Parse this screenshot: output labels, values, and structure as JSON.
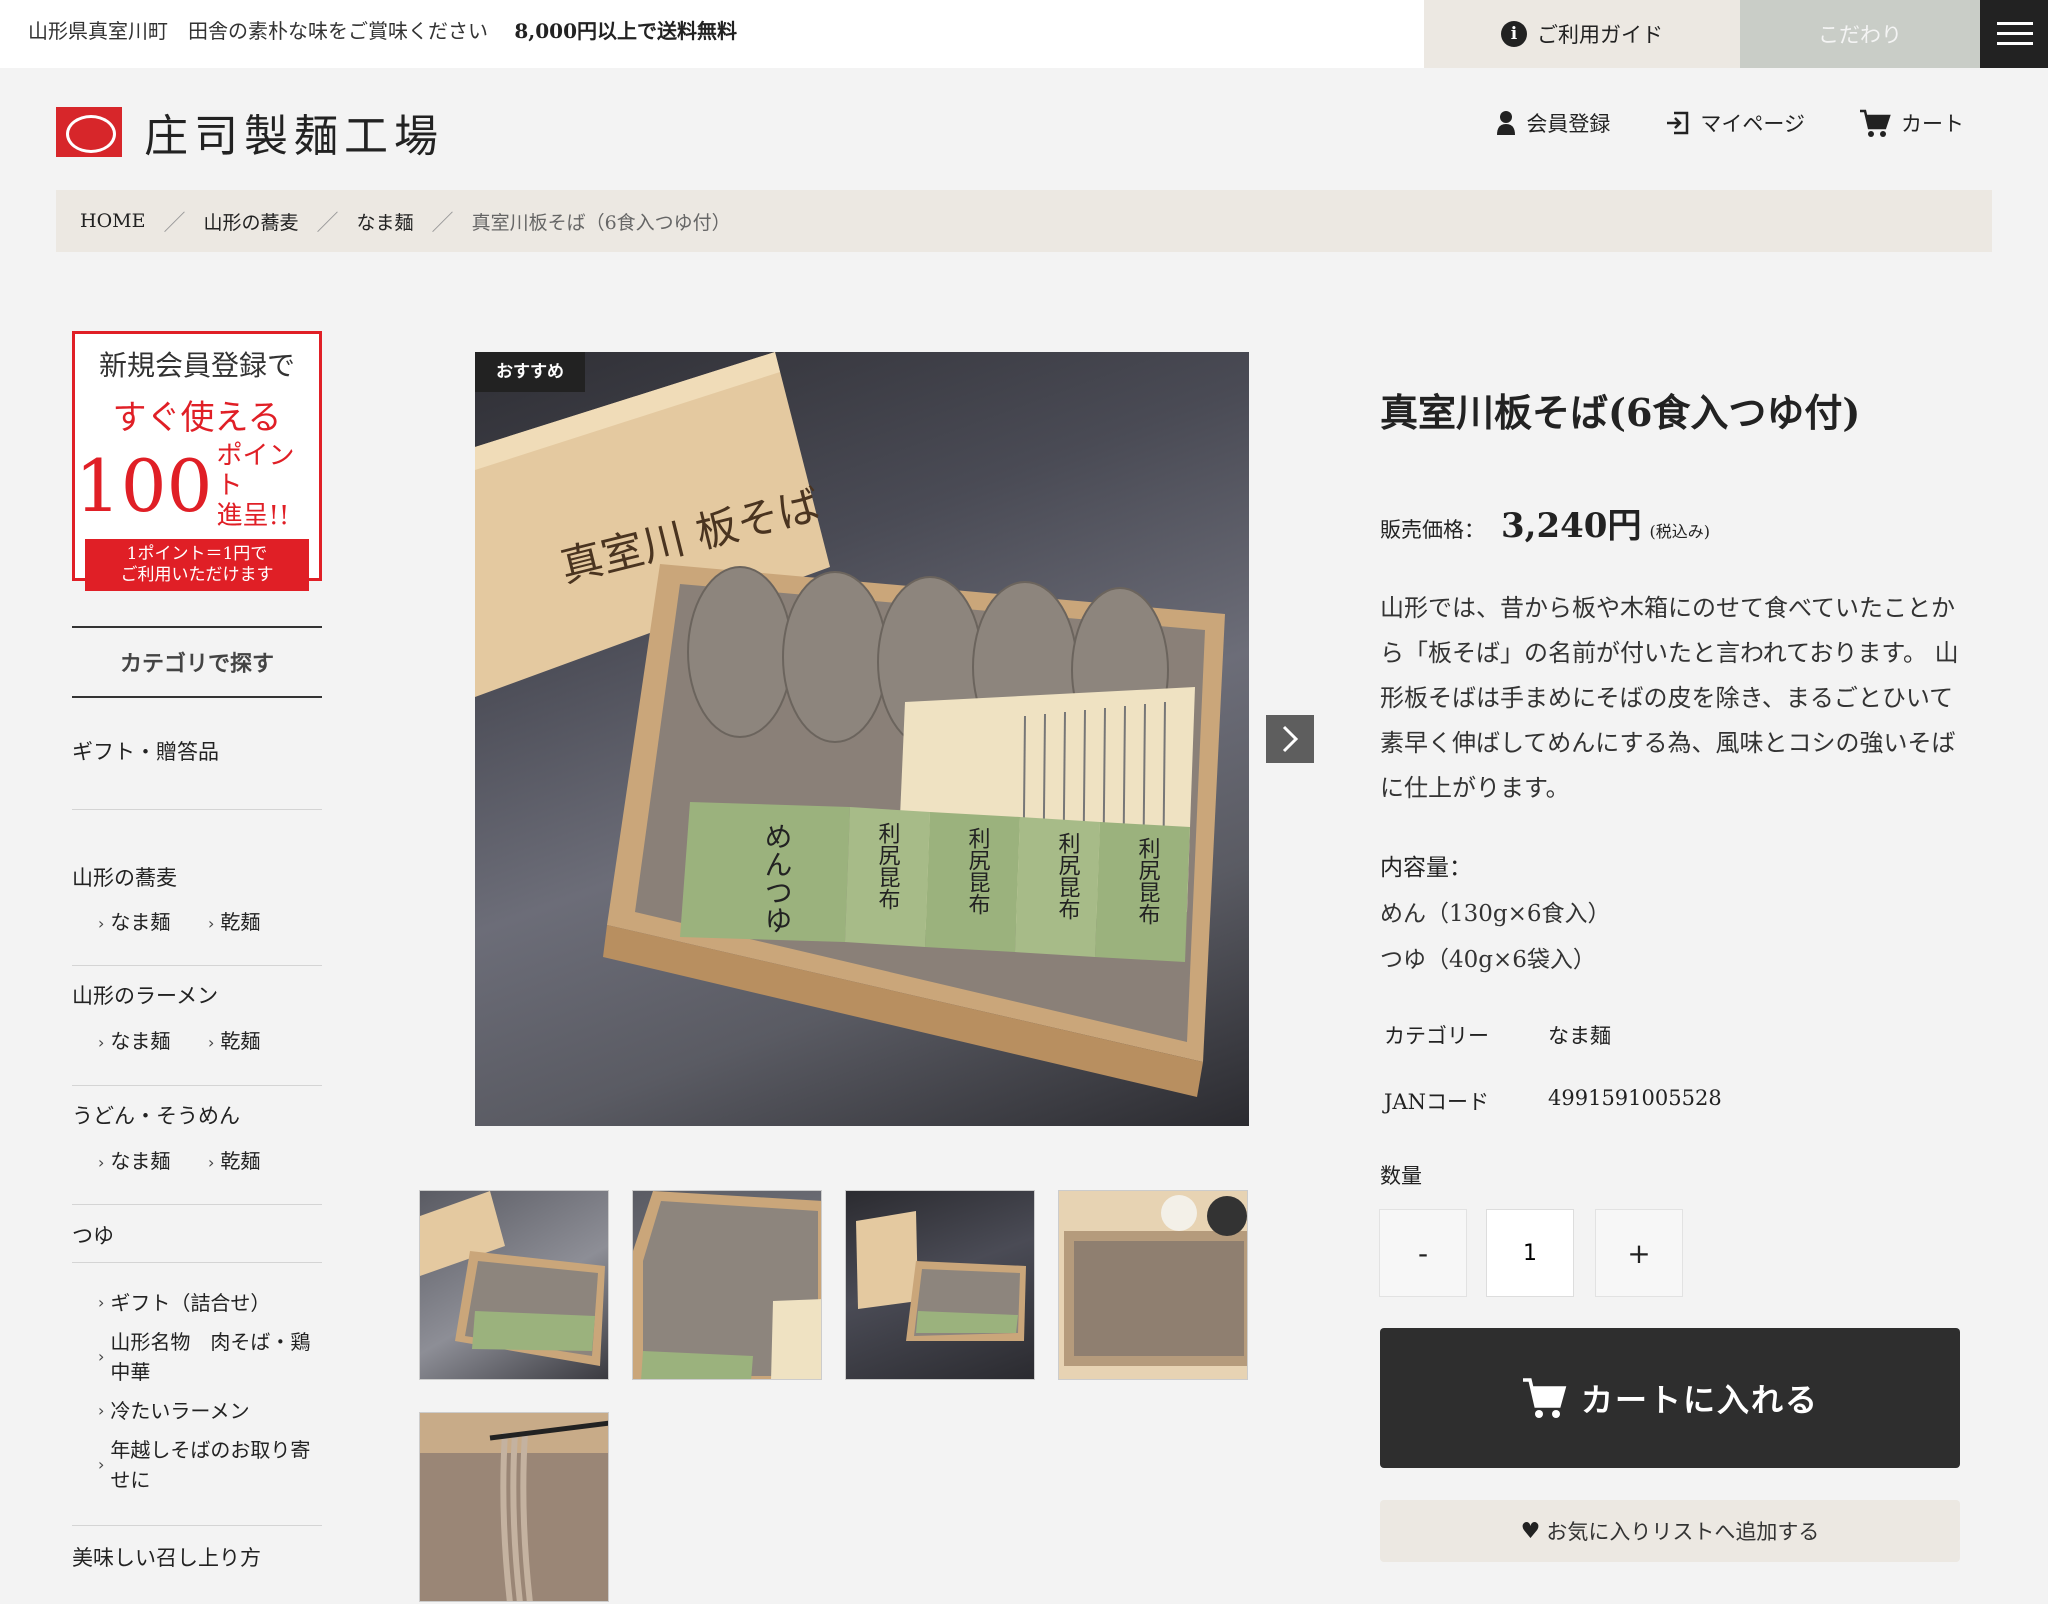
{
  "topbar": {
    "message": "山形県真室川町　田舎の素朴な味をご賞味ください",
    "free_shipping": "8,000円以上で送料無料",
    "guide_label": "ご利用ガイド",
    "guide_icon": "i",
    "kodawari_label": "こだわり"
  },
  "header": {
    "logo_text": "庄司製麺工場",
    "nav": {
      "register": "会員登録",
      "mypage": "マイページ",
      "cart": "カート"
    }
  },
  "breadcrumb": {
    "home": "HOME",
    "level1": "山形の蕎麦",
    "level2": "なま麺",
    "current": "真室川板そば（6食入つゆ付）",
    "separator": "／"
  },
  "promo": {
    "line1": "新規会員登録で",
    "line2": "すぐ使える",
    "number": "100",
    "unit": "ポイント",
    "present": "進呈!!",
    "note1": "1ポイント＝1円で",
    "note2": "ご利用いただけます"
  },
  "sidebar": {
    "category_heading": "カテゴリで探す",
    "gift": "ギフト・贈答品",
    "soba": {
      "label": "山形の蕎麦",
      "sub1": "なま麺",
      "sub2": "乾麺"
    },
    "ramen": {
      "label": "山形のラーメン",
      "sub1": "なま麺",
      "sub2": "乾麺"
    },
    "udon": {
      "label": "うどん・そうめん",
      "sub1": "なま麺",
      "sub2": "乾麺"
    },
    "tsuyu": "つゆ",
    "specials": [
      "ギフト（詰合せ）",
      "山形名物　肉そば・鶏中華",
      "冷たいラーメン",
      "年越しそばのお取り寄せに"
    ],
    "howto": "美味しい召し上り方",
    "chevron": "›"
  },
  "gallery": {
    "badge": "おすすめ",
    "box_lid_text": "真室川 板そば",
    "packet_text": "めんつゆ",
    "konbu_text": "利尻昆布",
    "thumbnail_count": 5
  },
  "product": {
    "title": "真室川板そば(6食入つゆ付)",
    "price_label": "販売価格：",
    "price": "3,240円",
    "tax_note": "(税込み)",
    "description": "山形では、昔から板や木箱にのせて食べていたことから「板そば」の名前が付いたと言われております。 山形板そばは手まめにそばの皮を除き、まるごとひいて素早く伸ばしてめんにする為、風味とコシの強いそばに仕上がります。",
    "content_label": "内容量：",
    "content_noodle": "めん（130g×6食入）",
    "content_soup": "つゆ（40g×6袋入）",
    "category_key": "カテゴリー",
    "category_value": "なま麺",
    "jan_key": "JANコード",
    "jan_value": "4991591005528",
    "qty_label": "数量",
    "qty_minus": "-",
    "qty_value": "1",
    "qty_plus": "+",
    "cart_button": "カートに入れる",
    "fav_button": "お気に入りリストへ追加する"
  },
  "colors": {
    "brand_red": "#e01f26",
    "dark": "#2e2e2e",
    "beige": "#ece8e2"
  }
}
